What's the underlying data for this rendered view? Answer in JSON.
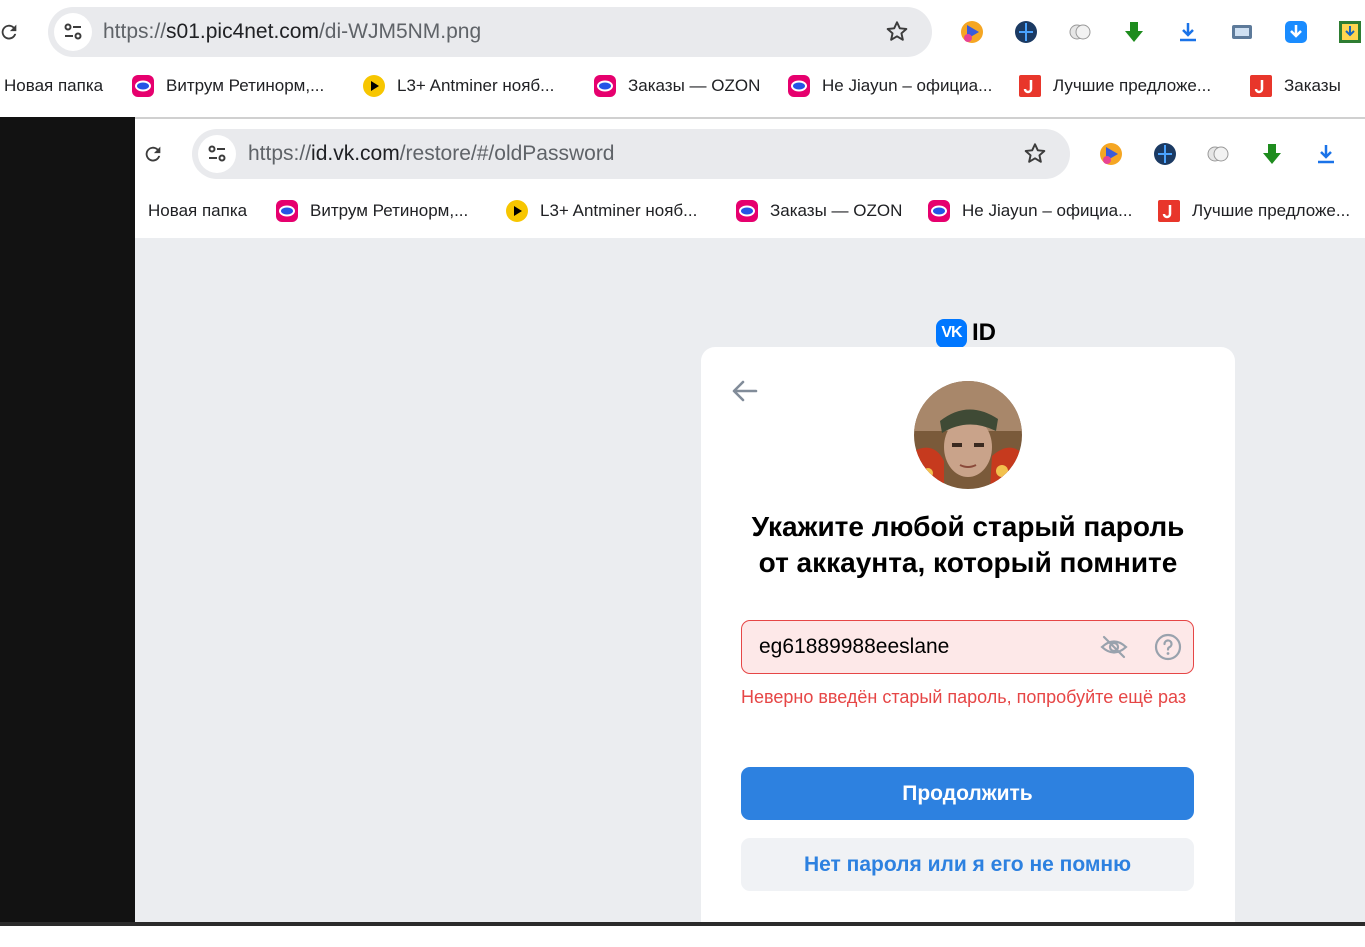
{
  "outer_browser": {
    "url_scheme": "https://",
    "url_host": "s01.pic4net.com",
    "url_path": "/di-WJM5NM.png",
    "bookmarks": [
      {
        "label": "Новая папка",
        "icon": "folder-icon"
      },
      {
        "label": "Витрум Ретинорм,...",
        "icon": "ozon-icon"
      },
      {
        "label": "L3+ Antminer нояб...",
        "icon": "play-icon"
      },
      {
        "label": "Заказы — OZON",
        "icon": "ozon-icon"
      },
      {
        "label": "He Jiayun – официа...",
        "icon": "ozon-icon"
      },
      {
        "label": "Лучшие предложе...",
        "icon": "red-j-icon"
      },
      {
        "label": "Заказы",
        "icon": "red-j-icon"
      }
    ]
  },
  "inner_browser": {
    "url_scheme": "https://",
    "url_host": "id.vk.com",
    "url_path": "/restore/#/oldPassword",
    "bookmarks": [
      {
        "label": "Новая папка",
        "icon": "folder-icon"
      },
      {
        "label": "Витрум Ретинорм,...",
        "icon": "ozon-icon"
      },
      {
        "label": "L3+ Antminer нояб...",
        "icon": "play-icon"
      },
      {
        "label": "Заказы — OZON",
        "icon": "ozon-icon"
      },
      {
        "label": "He Jiayun – официа...",
        "icon": "ozon-icon"
      },
      {
        "label": "Лучшие предложе...",
        "icon": "red-j-icon"
      }
    ]
  },
  "vk_page": {
    "logo_text": "ID",
    "heading_line1": "Укажите любой старый пароль",
    "heading_line2": "от аккаунта, который помните",
    "password_value": "eg61889988eeslane",
    "error_message": "Неверно введён старый пароль, попробуйте ещё раз",
    "continue_label": "Продолжить",
    "forgot_label": "Нет пароля или я его не помню"
  },
  "colors": {
    "vk_blue": "#0077ff",
    "button_blue": "#2d81e0",
    "error_red": "#e64646",
    "page_bg": "#ebedf0"
  }
}
